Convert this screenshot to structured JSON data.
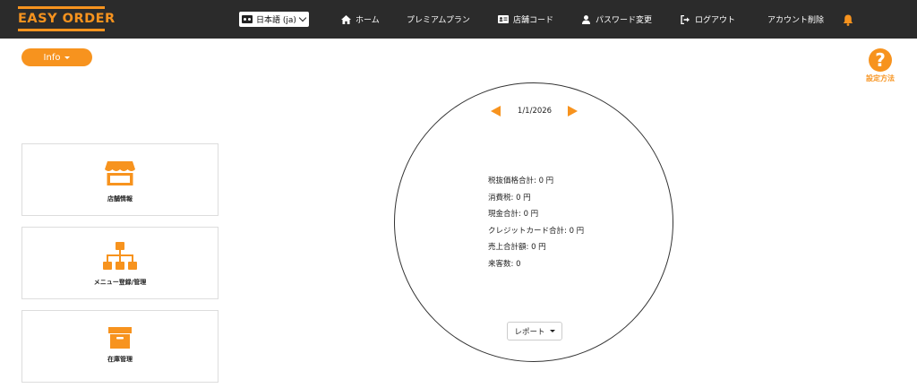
{
  "brand": {
    "logo_text": "EASY ORDER",
    "accent_color": "#f7931e",
    "navbar_color": "#2b2b2b"
  },
  "nav": {
    "language_selected": "日本語 (ja)",
    "items": [
      {
        "label": "ホーム",
        "icon": "home-icon"
      },
      {
        "label": "プレミアムプラン",
        "icon": ""
      },
      {
        "label": "店舗コード",
        "icon": "id-card-icon"
      },
      {
        "label": "パスワード変更",
        "icon": "user-icon"
      },
      {
        "label": "ログアウト",
        "icon": "sign-out-icon"
      },
      {
        "label": "アカウント削除",
        "icon": ""
      }
    ],
    "notification_icon": "bell-icon"
  },
  "toolbar": {
    "info_label": "Info"
  },
  "help": {
    "label": "設定方法",
    "glyph": "?"
  },
  "menu_cards": [
    {
      "label": "店舗情報",
      "icon": "store-icon"
    },
    {
      "label": "メニュー登録/管理",
      "icon": "sitemap-icon"
    },
    {
      "label": "在庫管理",
      "icon": "archive-box-icon"
    }
  ],
  "summary": {
    "date": "1/1/2026",
    "lines": [
      "税抜価格合計: 0 円",
      "消費税: 0 円",
      "現金合計: 0 円",
      "クレジットカード合計: 0 円",
      "売上合計額: 0 円",
      "来客数: 0"
    ],
    "report_label": "レポート"
  }
}
